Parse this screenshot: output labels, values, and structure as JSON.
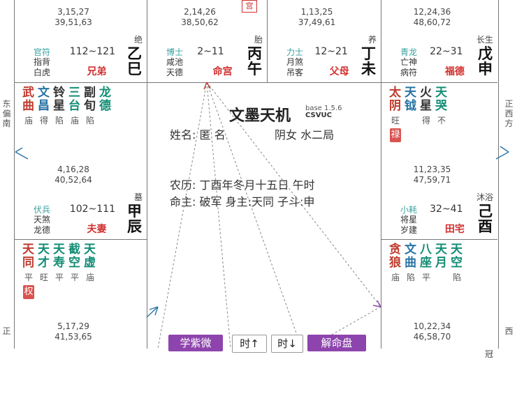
{
  "center": {
    "title": "文墨天机",
    "version": "base 1.5.6",
    "brand": "CSVUC",
    "name_line": "姓名: 匿 名",
    "gender_line": "阴女 水二局",
    "lunar_line": "农历: 丁酉年冬月十五日 午时",
    "master_line": "命主: 破军 身主:天同 子斗:申"
  },
  "seal_text": "宫",
  "directions": {
    "left_upper": "东偏南",
    "right_upper": "正西方",
    "left_lower": "正",
    "right_lower": "西"
  },
  "palaces": [
    {
      "key": "si",
      "nums1": "3,15,27",
      "nums2": "39,51,63",
      "state": "绝",
      "ganzhi": "乙巳",
      "cs": "官符",
      "small1": "指背",
      "small2": "白虎",
      "range": "112~121",
      "palace": "兄弟",
      "stars": []
    },
    {
      "key": "wu",
      "nums1": "2,14,26",
      "nums2": "38,50,62",
      "state": "胎",
      "ganzhi": "丙午",
      "cs": "博士",
      "small1": "咸池",
      "small2": "天德",
      "range": "2~11",
      "palace": "命宫",
      "stars": []
    },
    {
      "key": "wei",
      "nums1": "1,13,25",
      "nums2": "37,49,61",
      "state": "养",
      "ganzhi": "丁未",
      "cs": "力士",
      "small1": "月煞",
      "small2": "吊客",
      "range": "12~21",
      "palace": "父母",
      "stars": []
    },
    {
      "key": "shen",
      "nums1": "12,24,36",
      "nums2": "48,60,72",
      "state": "长生",
      "ganzhi": "戊申",
      "cs": "青龙",
      "small1": "亡神",
      "small2": "病符",
      "range": "22~31",
      "palace": "福德",
      "stars": []
    },
    {
      "key": "chen",
      "nums1": "4,16,28",
      "nums2": "40,52,64",
      "state": "墓",
      "ganzhi": "甲辰",
      "cs": "伏兵",
      "small1": "天煞",
      "small2": "龙德",
      "range": "102~111",
      "palace": "夫妻",
      "stars": [
        {
          "c": "武曲",
          "b": "庙",
          "color": "#c0392b"
        },
        {
          "c": "文昌",
          "b": "得",
          "color": "#2874a6"
        },
        {
          "c": "铃星",
          "b": "陷",
          "color": "#333333"
        },
        {
          "c": "三台",
          "b": "庙",
          "color": "#138d75"
        },
        {
          "c": "副旬",
          "b": "陷",
          "color": "#333333"
        },
        {
          "c": "龙德",
          "b": "",
          "color": "#138d75"
        }
      ]
    },
    {
      "key": "you",
      "nums1": "11,23,35",
      "nums2": "47,59,71",
      "state": "沐浴",
      "ganzhi": "己酉",
      "cs": "小耗",
      "small1": "将星",
      "small2": "岁建",
      "range": "32~41",
      "palace": "田宅",
      "stars": [
        {
          "c": "太阴",
          "b": "旺",
          "color": "#c0392b",
          "hua": "禄"
        },
        {
          "c": "天钺",
          "b": "",
          "color": "#2874a6"
        },
        {
          "c": "火星",
          "b": "得",
          "color": "#333333"
        },
        {
          "c": "天哭",
          "b": "不",
          "color": "#138d75"
        }
      ]
    },
    {
      "key": "mao",
      "nums1": "5,17,29",
      "nums2": "41,53,65",
      "state": "",
      "ganzhi": "",
      "cs": "",
      "small1": "",
      "small2": "",
      "range": "",
      "palace": "",
      "stars": [
        {
          "c": "天同",
          "b": "平",
          "color": "#c0392b",
          "hua": "权"
        },
        {
          "c": "天才",
          "b": "旺",
          "color": "#138d75"
        },
        {
          "c": "天寿",
          "b": "平",
          "color": "#138d75"
        },
        {
          "c": "截空",
          "b": "平",
          "color": "#138d75"
        },
        {
          "c": "天虚",
          "b": "庙",
          "color": "#138d75"
        }
      ]
    },
    {
      "key": "xu",
      "nums1": "10,22,34",
      "nums2": "46,58,70",
      "state": "冠",
      "ganzhi": "",
      "cs": "",
      "small1": "",
      "small2": "",
      "range": "",
      "palace": "",
      "stars": [
        {
          "c": "贪狼",
          "b": "庙",
          "color": "#c0392b"
        },
        {
          "c": "文曲",
          "b": "陷",
          "color": "#2874a6"
        },
        {
          "c": "八座",
          "b": "平",
          "color": "#138d75"
        },
        {
          "c": "天月",
          "b": "",
          "color": "#138d75"
        },
        {
          "c": "天空",
          "b": "陷",
          "color": "#138d75"
        }
      ]
    }
  ],
  "buttons": [
    {
      "label": "学紫微",
      "color": "#8e44ad"
    },
    {
      "label": "时↑",
      "color": "#ffffff"
    },
    {
      "label": "时↓",
      "color": "#ffffff"
    },
    {
      "label": "解命盘",
      "color": "#8e44ad"
    }
  ]
}
